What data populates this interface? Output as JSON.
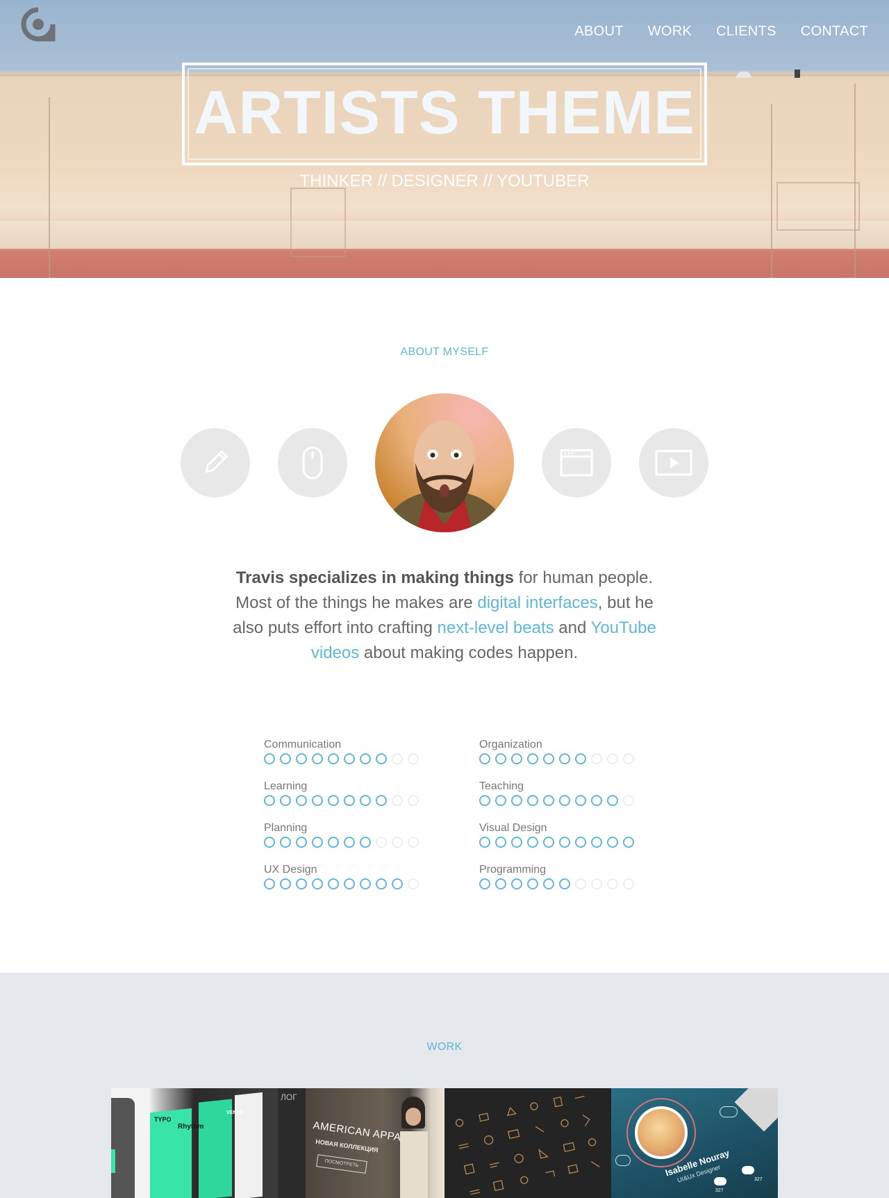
{
  "header": {
    "nav": [
      "ABOUT",
      "WORK",
      "CLIENTS",
      "CONTACT"
    ]
  },
  "hero": {
    "title": "ARTISTS THEME",
    "subtitle": "THINKER // DESIGNER // YOUTUBER"
  },
  "about": {
    "label": "ABOUT MYSELF",
    "icons": [
      "pencil-icon",
      "mouse-icon",
      "browser-window-icon",
      "video-play-icon"
    ],
    "bio": {
      "bold": "Travis specializes in making things",
      "t1": " for human people. Most of the things he makes are ",
      "link1": "digital interfaces",
      "t2": ", but he also puts effort into crafting ",
      "link2": "next-level beats",
      "t3": " and ",
      "link3": "YouTube videos",
      "t4": " about making codes happen."
    }
  },
  "skills": [
    {
      "name": "Communication",
      "level": 8,
      "max": 10
    },
    {
      "name": "Organization",
      "level": 7,
      "max": 10
    },
    {
      "name": "Learning",
      "level": 8,
      "max": 10
    },
    {
      "name": "Teaching",
      "level": 9,
      "max": 10
    },
    {
      "name": "Planning",
      "level": 7,
      "max": 10
    },
    {
      "name": "Visual Design",
      "level": 10,
      "max": 10
    },
    {
      "name": "UX Design",
      "level": 9,
      "max": 10
    },
    {
      "name": "Programming",
      "level": 6,
      "max": 10
    }
  ],
  "work": {
    "label": "WORK",
    "thumbs": [
      {
        "name": "typo-app",
        "texts": [
          "TYPO",
          "Rhythm",
          "VENUE"
        ]
      },
      {
        "name": "american-apparel",
        "texts": [
          "AMERICAN APPAREL",
          "НОВАЯ КОЛЛЕКЦИЯ",
          "ПОСМОТРЕТЬ",
          "ЛОГ"
        ]
      },
      {
        "name": "icon-set",
        "texts": []
      },
      {
        "name": "profile-app",
        "texts": [
          "Isabelle Nouray",
          "UI&Ux Designer",
          "327",
          "327"
        ]
      }
    ]
  },
  "colors": {
    "accent": "#5eb7d6",
    "work_bg": "#e5e8ec"
  }
}
